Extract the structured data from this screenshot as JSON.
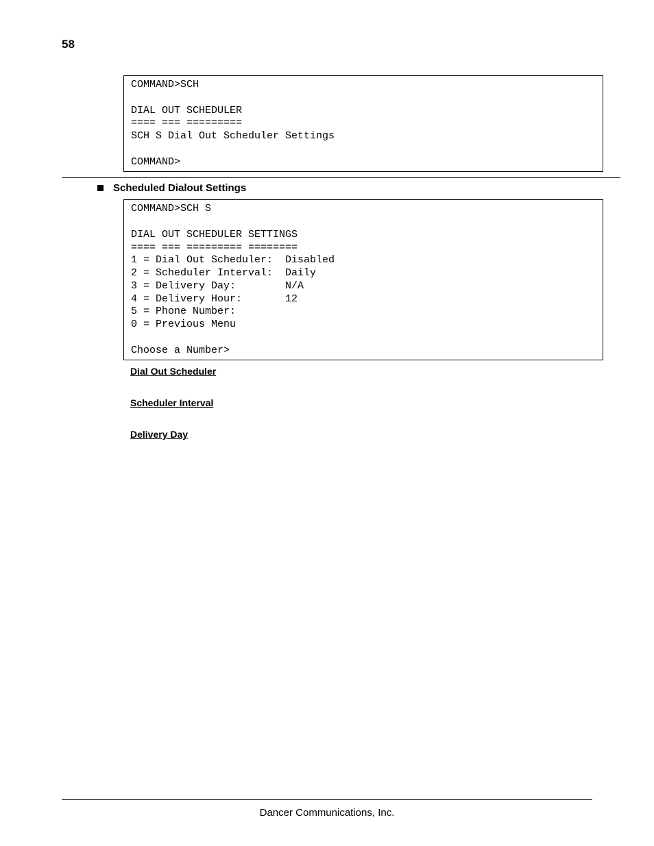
{
  "page_number": "58",
  "terminal1": "COMMAND>SCH\n\nDIAL OUT SCHEDULER\n==== === =========\nSCH S Dial Out Scheduler Settings\n\nCOMMAND>",
  "section_heading": "Scheduled Dialout Settings",
  "terminal2": "COMMAND>SCH S\n\nDIAL OUT SCHEDULER SETTINGS\n==== === ========= ========\n1 = Dial Out Scheduler:  Disabled\n2 = Scheduler Interval:  Daily\n3 = Delivery Day:        N/A\n4 = Delivery Hour:       12\n5 = Phone Number:\n0 = Previous Menu\n\nChoose a Number>",
  "subheadings": {
    "h1": "Dial Out Scheduler",
    "h2": "Scheduler Interval",
    "h3": "Delivery Day"
  },
  "footer": "Dancer Communications, Inc."
}
